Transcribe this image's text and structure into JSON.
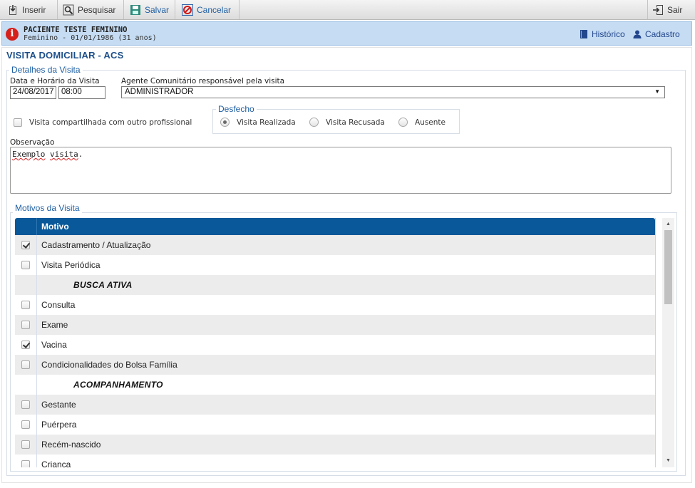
{
  "toolbar": {
    "insert_label": "Inserir",
    "search_label": "Pesquisar",
    "save_label": "Salvar",
    "cancel_label": "Cancelar",
    "exit_label": "Sair"
  },
  "patient": {
    "name": "PACIENTE TESTE FEMININO",
    "info": "Feminino - 01/01/1986 (31 anos)",
    "history_label": "Histórico",
    "register_label": "Cadastro"
  },
  "page": {
    "title": "VISITA DOMICILIAR - ACS"
  },
  "details": {
    "legend": "Detalhes da Visita",
    "datetime_label": "Data e Horário da Visita",
    "date_value": "24/08/2017",
    "time_value": "08:00",
    "agent_label": "Agente Comunitário responsável pela visita",
    "agent_value": "ADMINISTRADOR",
    "shared_label": "Visita compartilhada com outro profissional",
    "outcome_legend": "Desfecho",
    "outcomes": [
      {
        "label": "Visita Realizada",
        "selected": true
      },
      {
        "label": "Visita Recusada",
        "selected": false
      },
      {
        "label": "Ausente",
        "selected": false
      }
    ],
    "observation_label": "Observação",
    "observation_word1": "Exemplo",
    "observation_word2": "visita",
    "observation_tail": "."
  },
  "reasons": {
    "legend": "Motivos da Visita",
    "column_header": "Motivo",
    "rows": [
      {
        "label": "Cadastramento / Atualização",
        "checked": true,
        "section": false
      },
      {
        "label": "Visita Periódica",
        "checked": false,
        "section": false
      },
      {
        "label": "BUSCA ATIVA",
        "checked": false,
        "section": true
      },
      {
        "label": "Consulta",
        "checked": false,
        "section": false
      },
      {
        "label": "Exame",
        "checked": false,
        "section": false
      },
      {
        "label": "Vacina",
        "checked": true,
        "section": false
      },
      {
        "label": "Condicionalidades do Bolsa Família",
        "checked": false,
        "section": false
      },
      {
        "label": "ACOMPANHAMENTO",
        "checked": false,
        "section": true
      },
      {
        "label": "Gestante",
        "checked": false,
        "section": false
      },
      {
        "label": "Puérpera",
        "checked": false,
        "section": false
      },
      {
        "label": "Recém-nascido",
        "checked": false,
        "section": false
      },
      {
        "label": "Criança",
        "checked": false,
        "section": false
      }
    ]
  },
  "colors": {
    "accent": "#1f5fa3",
    "table_header": "#08589a",
    "patient_bar": "#c5dcf3",
    "alert": "#d6201c"
  }
}
